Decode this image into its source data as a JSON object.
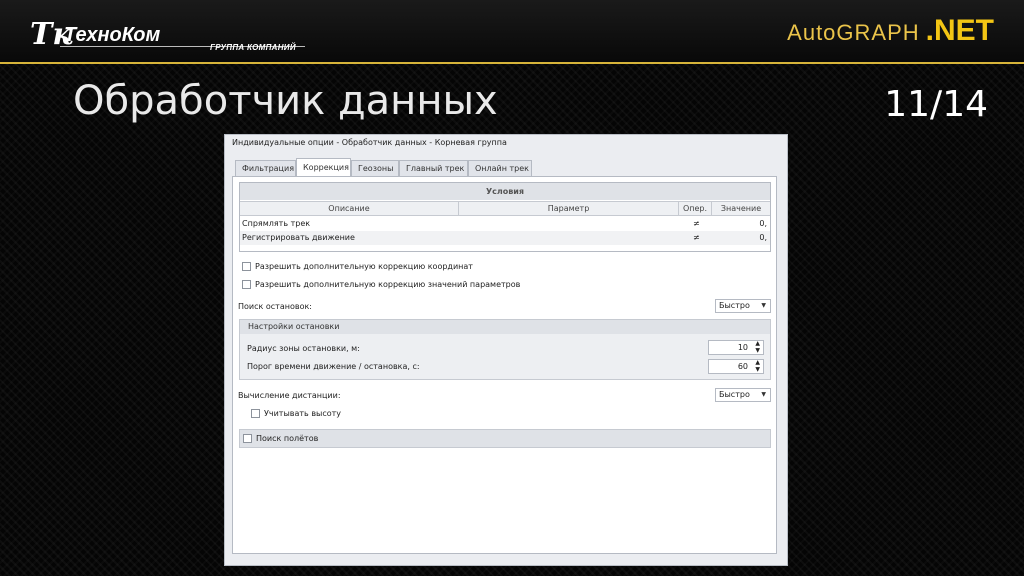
{
  "header": {
    "brand_mark": "Тк",
    "brand_name": "ТехноКом",
    "brand_sub": "ГРУППА КОМПАНИЙ",
    "product_name": "AutoGRAPH",
    "product_suffix": ".NET",
    "accent_color": "#d7b43a"
  },
  "slide": {
    "title": "Обработчик данных",
    "page": "11/14"
  },
  "window": {
    "title": "Индивидуальные опции - Обработчик данных - Корневая группа",
    "tabs": [
      {
        "label": "Фильтрация",
        "active": false
      },
      {
        "label": "Коррекция",
        "active": true
      },
      {
        "label": "Геозоны",
        "active": false
      },
      {
        "label": "Главный трек",
        "active": false
      },
      {
        "label": "Онлайн трек",
        "active": false
      }
    ],
    "conditions": {
      "caption": "Условия",
      "columns": [
        "Описание",
        "Параметр",
        "Опер.",
        "Значение"
      ],
      "rows": [
        {
          "desc": "Спрямлять трек",
          "param": "",
          "op": "≠",
          "value": "0,"
        },
        {
          "desc": "Регистрировать движение",
          "param": "",
          "op": "≠",
          "value": "0,"
        }
      ]
    },
    "checkboxes": {
      "coord_correction": {
        "label": "Разрешить дополнительную коррекцию координат",
        "checked": false
      },
      "param_correction": {
        "label": "Разрешить дополнительную коррекцию значений параметров",
        "checked": false
      }
    },
    "stop_search": {
      "label": "Поиск остановок:",
      "value": "Быстро"
    },
    "stop_settings": {
      "title": "Настройки остановки",
      "radius": {
        "label": "Радиус зоны остановки, м:",
        "value": "10"
      },
      "threshold": {
        "label": "Порог времени движение / остановка, с:",
        "value": "60"
      }
    },
    "distance": {
      "label": "Вычисление дистанции:",
      "value": "Быстро"
    },
    "altitude": {
      "label": "Учитывать высоту",
      "checked": false
    },
    "flight_search": {
      "label": "Поиск полётов",
      "checked": false
    }
  }
}
